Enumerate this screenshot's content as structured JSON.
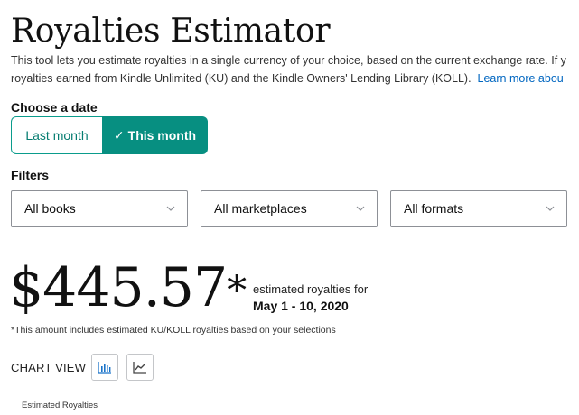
{
  "page": {
    "title": "Royalties Estimator",
    "description_line1": "This tool lets you estimate royalties in a single currency of your choice, based on the current exchange rate. If y",
    "description_line2": "royalties earned from Kindle Unlimited (KU) and the Kindle Owners' Lending Library (KOLL).",
    "learn_more": "Learn more abou"
  },
  "date_section": {
    "label": "Choose a date",
    "options": [
      {
        "label": "Last month",
        "selected": false
      },
      {
        "label": "This month",
        "selected": true
      }
    ],
    "check_glyph": "✓"
  },
  "filters": {
    "label": "Filters",
    "books": "All books",
    "marketplaces": "All marketplaces",
    "formats": "All formats"
  },
  "summary": {
    "amount": "$445.57",
    "asterisk": "*",
    "estimated_label": "estimated royalties for",
    "date_range": "May 1 - 10, 2020",
    "footnote": "*This amount includes estimated KU/KOLL royalties based on your selections"
  },
  "chart_view": {
    "label": "CHART VIEW",
    "active": "bar",
    "icons": [
      "bar-chart-icon",
      "line-chart-icon"
    ],
    "y_axis_label": "Estimated Royalties"
  },
  "colors": {
    "accent": "#078f81",
    "accent_text": "#067d71",
    "link": "#0066c0",
    "icon_blue": "#1a73c9"
  }
}
